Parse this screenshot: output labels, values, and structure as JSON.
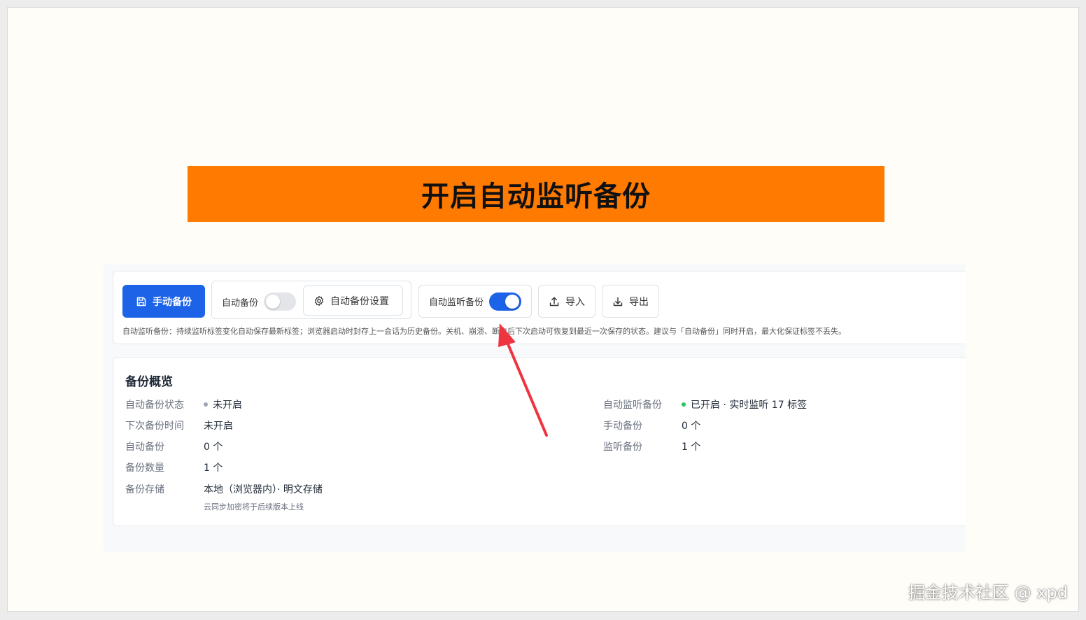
{
  "banner": {
    "title": "开启自动监听备份"
  },
  "toolbar": {
    "manual_backup": "手动备份",
    "auto_backup_label": "自动备份",
    "auto_backup_enabled": false,
    "auto_backup_settings": "自动备份设置",
    "listen_backup_label": "自动监听备份",
    "listen_backup_enabled": true,
    "import": "导入",
    "export": "导出",
    "hint": "自动监听备份：持续监听标签变化自动保存最新标签；浏览器启动时封存上一会话为历史备份。关机、崩溃、断电后下次启动可恢复到最近一次保存的状态。建议与「自动备份」同时开启，最大化保证标签不丢失。"
  },
  "overview": {
    "title": "备份概览",
    "left": [
      {
        "key": "自动备份状态",
        "value": "未开启",
        "dot": "#9ca3af"
      },
      {
        "key": "下次备份时间",
        "value": "未开启"
      },
      {
        "key": "自动备份",
        "value": "0 个"
      },
      {
        "key": "备份数量",
        "value": "1 个"
      },
      {
        "key": "备份存储",
        "value": "本地（浏览器内）· 明文存储",
        "sub": "云同步加密将于后续版本上线"
      }
    ],
    "right": [
      {
        "key": "自动监听备份",
        "value": "已开启 · 实时监听 17 标签",
        "dot": "#22c55e"
      },
      {
        "key": "手动备份",
        "value": "0 个"
      },
      {
        "key": "监听备份",
        "value": "1 个"
      }
    ]
  },
  "colors": {
    "accent": "#1d63e8",
    "banner": "#ff7a00",
    "arrow": "#ef3340"
  },
  "watermark": "掘金技术社区 @ xpd"
}
